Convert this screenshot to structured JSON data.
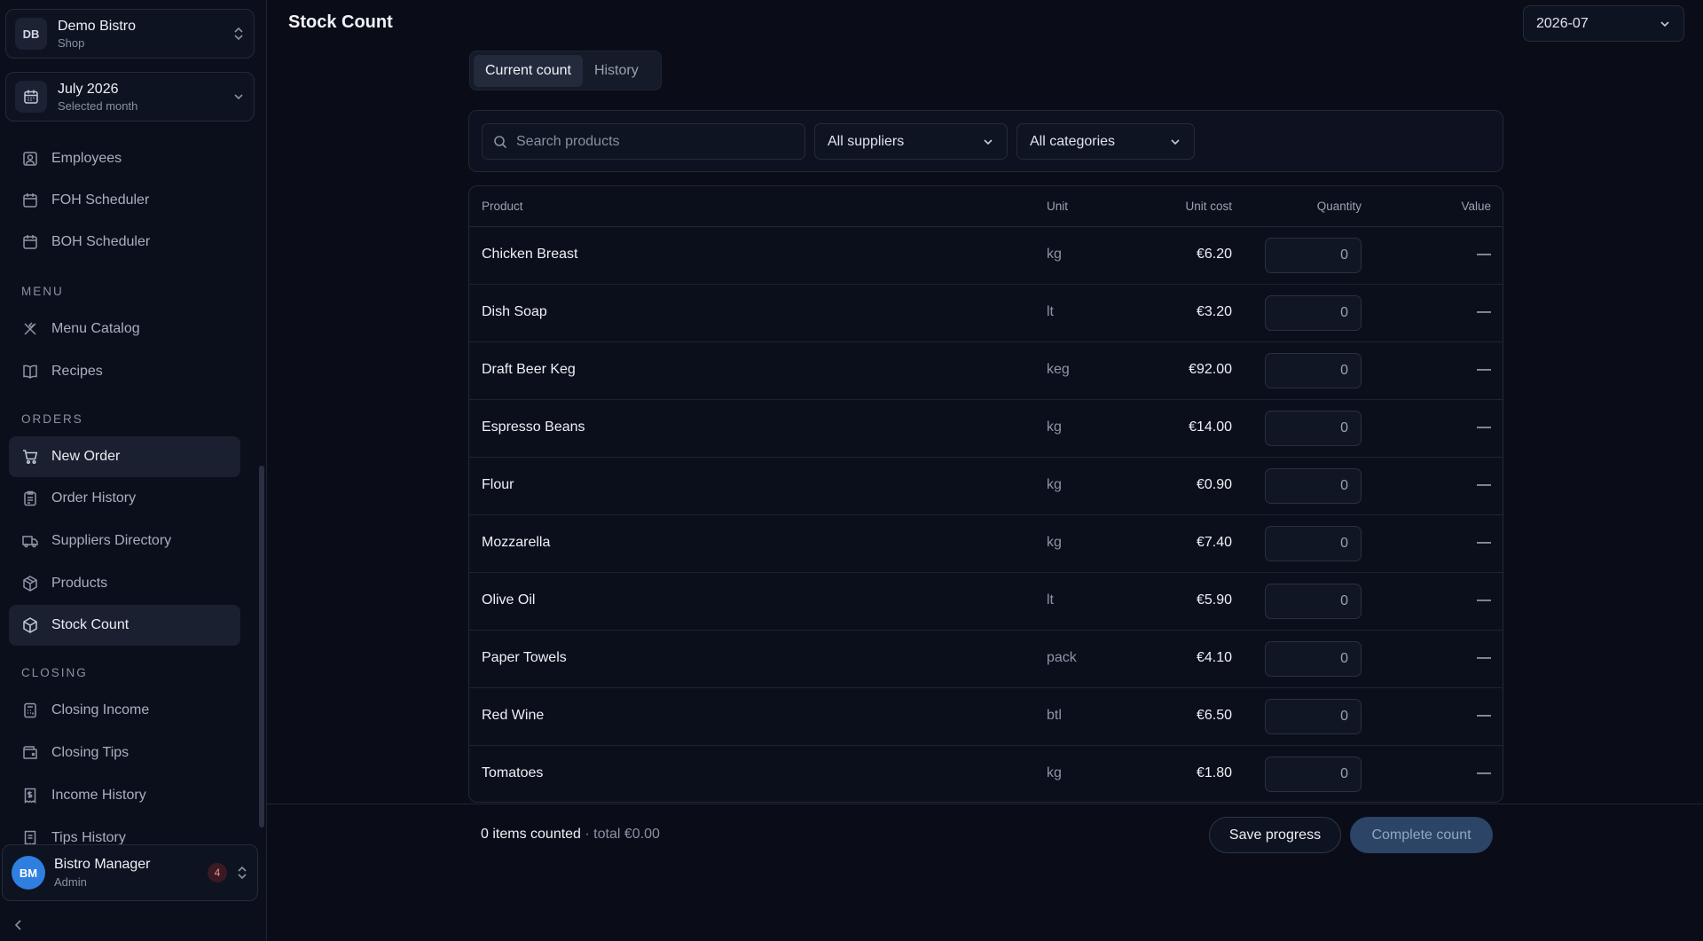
{
  "workspace": {
    "initials": "DB",
    "name": "Demo Bistro",
    "type": "Shop"
  },
  "period": {
    "label": "July 2026",
    "sub": "Selected month"
  },
  "nav": {
    "top_items": [
      {
        "label": "Employees",
        "icon": "user-square-icon"
      },
      {
        "label": "FOH Scheduler",
        "icon": "calendar-icon"
      },
      {
        "label": "BOH Scheduler",
        "icon": "calendar-icon"
      }
    ],
    "sections": [
      {
        "title": "MENU",
        "items": [
          {
            "label": "Menu Catalog",
            "icon": "utensils-crossed-icon"
          },
          {
            "label": "Recipes",
            "icon": "book-open-icon"
          }
        ]
      },
      {
        "title": "ORDERS",
        "items": [
          {
            "label": "New Order",
            "icon": "shopping-cart-icon"
          },
          {
            "label": "Order History",
            "icon": "clipboard-list-icon"
          },
          {
            "label": "Suppliers Directory",
            "icon": "truck-icon"
          },
          {
            "label": "Products",
            "icon": "package-icon"
          },
          {
            "label": "Stock Count",
            "icon": "package-icon"
          }
        ]
      },
      {
        "title": "CLOSING",
        "items": [
          {
            "label": "Closing Income",
            "icon": "calculator-icon"
          },
          {
            "label": "Closing Tips",
            "icon": "wallet-icon"
          },
          {
            "label": "Income History",
            "icon": "receipt-icon"
          },
          {
            "label": "Tips History",
            "icon": "receipt-icon"
          }
        ]
      }
    ]
  },
  "user": {
    "initials": "BM",
    "name": "Bistro Manager",
    "role": "Admin",
    "notifications": "4"
  },
  "header": {
    "title": "Stock Count",
    "month": "2026-07"
  },
  "tabs": [
    {
      "label": "Current count",
      "active": true
    },
    {
      "label": "History",
      "active": false
    }
  ],
  "filters": {
    "search_placeholder": "Search products",
    "supplier": "All suppliers",
    "category": "All categories"
  },
  "table": {
    "columns": {
      "product": "Product",
      "unit": "Unit",
      "unit_cost": "Unit cost",
      "quantity": "Quantity",
      "value": "Value"
    },
    "rows": [
      {
        "product": "Chicken Breast",
        "unit": "kg",
        "cost": "€6.20",
        "qty": "0",
        "value": "—"
      },
      {
        "product": "Dish Soap",
        "unit": "lt",
        "cost": "€3.20",
        "qty": "0",
        "value": "—"
      },
      {
        "product": "Draft Beer Keg",
        "unit": "keg",
        "cost": "€92.00",
        "qty": "0",
        "value": "—"
      },
      {
        "product": "Espresso Beans",
        "unit": "kg",
        "cost": "€14.00",
        "qty": "0",
        "value": "—"
      },
      {
        "product": "Flour",
        "unit": "kg",
        "cost": "€0.90",
        "qty": "0",
        "value": "—"
      },
      {
        "product": "Mozzarella",
        "unit": "kg",
        "cost": "€7.40",
        "qty": "0",
        "value": "—"
      },
      {
        "product": "Olive Oil",
        "unit": "lt",
        "cost": "€5.90",
        "qty": "0",
        "value": "—"
      },
      {
        "product": "Paper Towels",
        "unit": "pack",
        "cost": "€4.10",
        "qty": "0",
        "value": "—"
      },
      {
        "product": "Red Wine",
        "unit": "btl",
        "cost": "€6.50",
        "qty": "0",
        "value": "—"
      },
      {
        "product": "Tomatoes",
        "unit": "kg",
        "cost": "€1.80",
        "qty": "0",
        "value": "—"
      }
    ]
  },
  "footer": {
    "count_text": "0 items counted",
    "total_text": "· total €0.00",
    "save_label": "Save progress",
    "complete_label": "Complete count"
  },
  "colors": {
    "background": "#0a0d18",
    "accent_button": "#2c4466",
    "avatar": "#2f7fe0"
  }
}
